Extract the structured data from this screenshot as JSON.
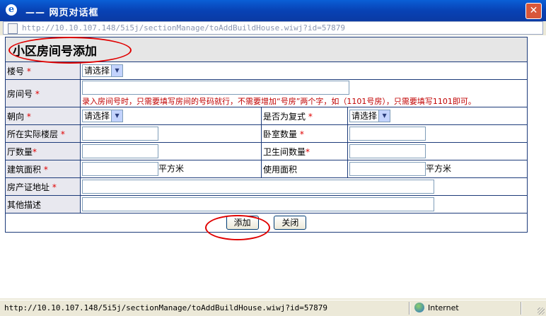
{
  "window": {
    "title": "—— 网页对话框",
    "url": "http://10.10.107.148/5i5j/sectionManage/toAddBuildHouse.wiwj?id=57879"
  },
  "form": {
    "heading": "小区房间号添加",
    "building_label": "楼号",
    "building_value": "请选择",
    "room_label": "房间号",
    "room_note": "录入房间号时，只需要填写房间的号码就行，不需要增加“号房”两个字，如（1101号房），只需要填写1101即可。",
    "orientation_label": "朝向",
    "orientation_value": "请选择",
    "duplex_label": "是否为复式",
    "duplex_value": "请选择",
    "floor_label": "所在实际楼层",
    "bedroom_label": "卧室数量",
    "hall_label": "厅数量",
    "bathroom_label": "卫生间数量",
    "area_label": "建筑面积",
    "area_unit": "平方米",
    "usable_label": "使用面积",
    "usable_unit": "平方米",
    "cert_label": "房产证地址",
    "desc_label": "其他描述",
    "add_button": "添加",
    "close_button": "关闭",
    "required_mark": "*"
  },
  "statusbar": {
    "url": "http://10.10.107.148/5i5j/sectionManage/toAddBuildHouse.wiwj?id=57879",
    "zone": "Internet"
  },
  "colors": {
    "titlebar": "#0842b5",
    "required": "#e00000",
    "annotation": "#e00000",
    "label_bg": "#e8e8ef"
  }
}
